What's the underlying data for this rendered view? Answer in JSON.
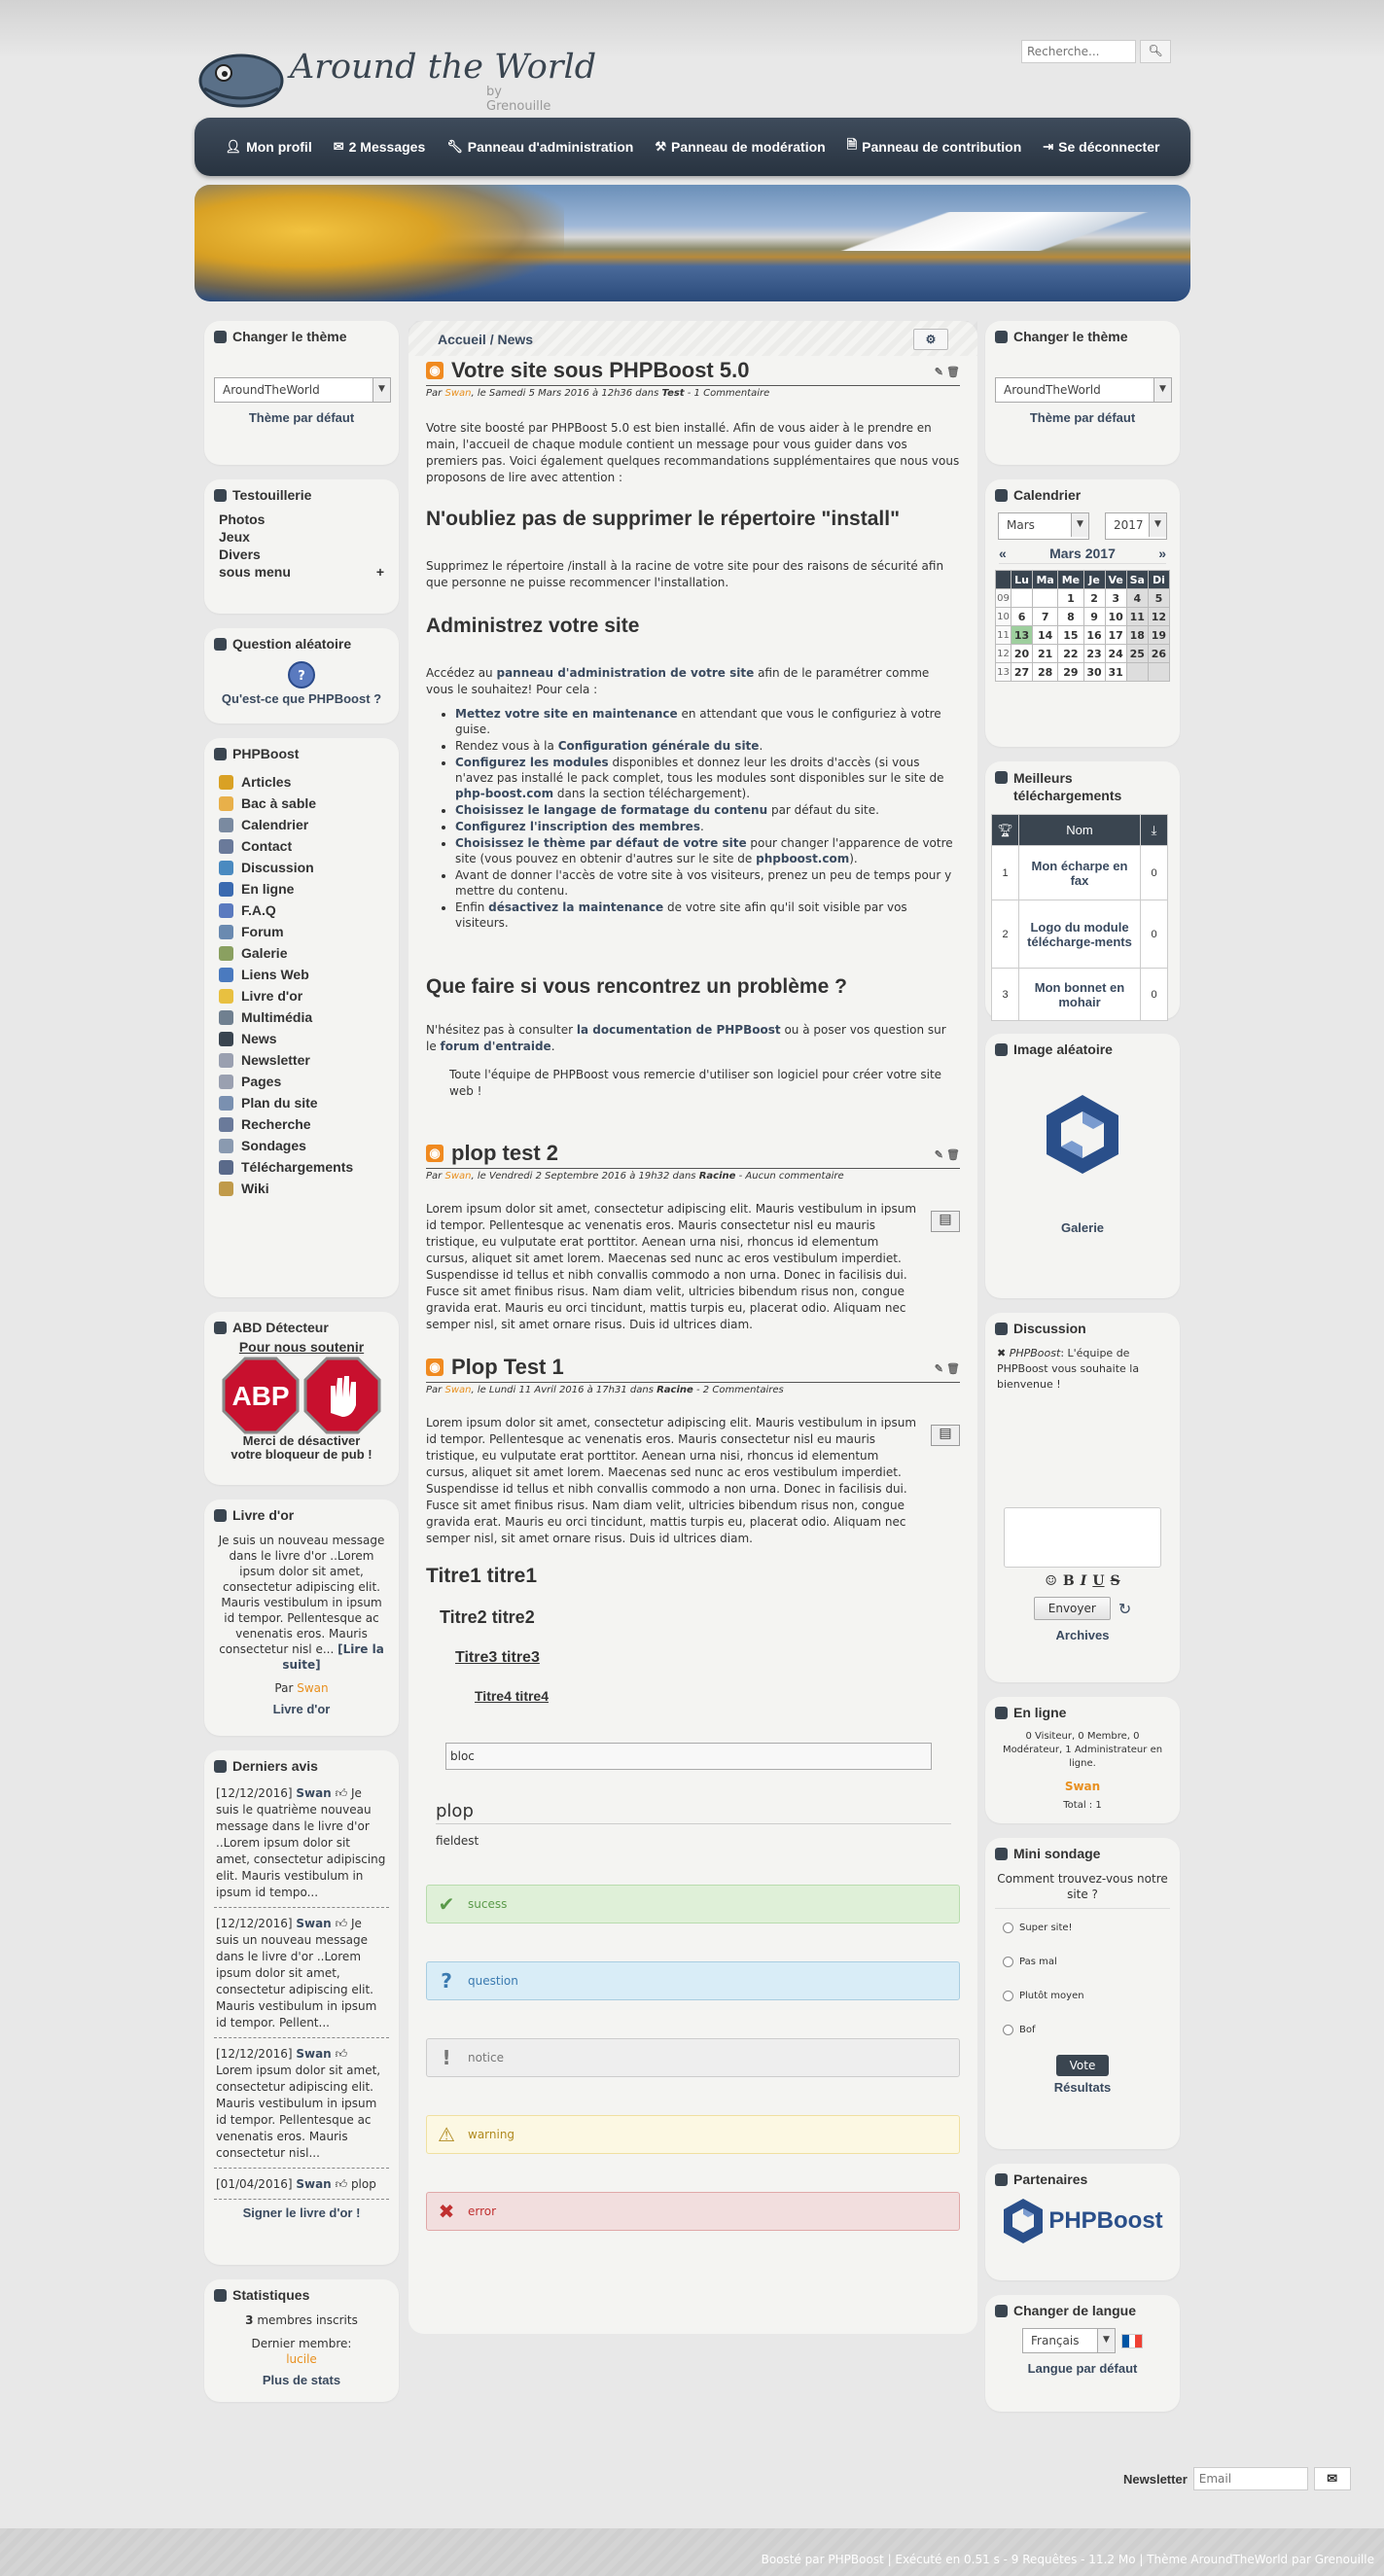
{
  "site": {
    "title": "Around the World",
    "subtitle": "by Grenouille"
  },
  "search": {
    "placeholder": "Recherche..."
  },
  "menu": [
    {
      "icon": "user-icon",
      "label": "Mon profil"
    },
    {
      "icon": "envelope-icon",
      "label": "2 Messages"
    },
    {
      "icon": "wrench-icon",
      "label": "Panneau d'administration"
    },
    {
      "icon": "gavel-icon",
      "label": "Panneau de modération"
    },
    {
      "icon": "file-icon",
      "label": "Panneau de contribution"
    },
    {
      "icon": "sign-out-icon",
      "label": "Se déconnecter"
    }
  ],
  "left": {
    "theme": {
      "title": "Changer le thème",
      "selected": "AroundTheWorld",
      "default_link": "Thème par défaut"
    },
    "testouillerie": {
      "title": "Testouillerie",
      "items": [
        "Photos",
        "Jeux",
        "Divers",
        "sous menu"
      ],
      "expand": "+"
    },
    "random_question": {
      "title": "Question aléatoire",
      "icon_text": "?",
      "link": "Qu'est-ce que PHPBoost ?"
    },
    "phpboost": {
      "title": "PHPBoost",
      "items": [
        "Articles",
        "Bac à sable",
        "Calendrier",
        "Contact",
        "Discussion",
        "En ligne",
        "F.A.Q",
        "Forum",
        "Galerie",
        "Liens Web",
        "Livre d'or",
        "Multimédia",
        "News",
        "Newsletter",
        "Pages",
        "Plan du site",
        "Recherche",
        "Sondages",
        "Téléchargements",
        "Wiki"
      ]
    },
    "abd": {
      "title": "ABD Détecteur",
      "top": "Pour nous soutenir",
      "abp": "ABP",
      "bottom1": "Merci de désactiver",
      "bottom2": "votre bloqueur de pub !"
    },
    "guestbook": {
      "title": "Livre d'or",
      "text": "Je suis un nouveau message dans le livre d'or ..Lorem ipsum dolor sit amet, consectetur adipiscing elit. Mauris vestibulum in ipsum id tempor. Pellentesque ac venenatis eros. Mauris consectetur nisl e...",
      "read": "[Lire la suite]",
      "by": "Par",
      "author": "Swan",
      "link": "Livre d'or"
    },
    "reviews": {
      "title": "Derniers avis",
      "items": [
        {
          "date": "[12/12/2016]",
          "user": "Swan",
          "text": "Je suis le quatrième nouveau message dans le livre d'or ..Lorem ipsum dolor sit amet, consectetur adipiscing elit. Mauris vestibulum in ipsum id tempo..."
        },
        {
          "date": "[12/12/2016]",
          "user": "Swan",
          "text": "Je suis un nouveau message dans le livre d'or ..Lorem ipsum dolor sit amet, consectetur adipiscing elit. Mauris vestibulum in ipsum id tempor. Pellent..."
        },
        {
          "date": "[12/12/2016]",
          "user": "Swan",
          "text": "Lorem ipsum dolor sit amet, consectetur adipiscing elit. Mauris vestibulum in ipsum id tempor. Pellentesque ac venenatis eros. Mauris consectetur nisl..."
        },
        {
          "date": "[01/04/2016]",
          "user": "Swan",
          "text": "plop"
        }
      ],
      "sign": "Signer le livre d'or !"
    },
    "stats": {
      "title": "Statistiques",
      "members": "3",
      "members_label": "membres inscrits",
      "last_label": "Dernier membre:",
      "last": "lucile",
      "more": "Plus de stats"
    }
  },
  "main": {
    "breadcrumb": {
      "home": "Accueil",
      "sep": "/",
      "current": "News"
    },
    "settings_icon": "gear-icon",
    "articles": [
      {
        "title": "Votre site sous PHPBoost 5.0",
        "meta_by": "Par",
        "author": "Swan",
        "meta_date": ", le Samedi 5 Mars 2016 à 12h36 dans",
        "category": "Test",
        "comments": "- 1 Commentaire"
      },
      {
        "title": "plop test 2",
        "meta_by": "Par",
        "author": "Swan",
        "meta_date": ", le Vendredi 2 Septembre 2016 à 19h32 dans",
        "category": "Racine",
        "comments": "- Aucun commentaire"
      },
      {
        "title": "Plop Test 1",
        "meta_by": "Par",
        "author": "Swan",
        "meta_date": ", le Lundi 11 Avril 2016 à 17h31 dans",
        "category": "Racine",
        "comments": "- 2 Commentaires"
      }
    ],
    "intro": "Votre site boosté par PHPBoost 5.0 est bien installé. Afin de vous aider à le prendre en main, l'accueil de chaque module contient un message pour vous guider dans vos premiers pas. Voici également quelques recommandations supplémentaires que nous vous proposons de lire avec attention :",
    "h_install": "N'oubliez pas de supprimer le répertoire \"install\"",
    "p_install": "Supprimez le répertoire /install à la racine de votre site pour des raisons de sécurité afin que personne ne puisse recommencer l'installation.",
    "h_admin": "Administrez votre site",
    "p_admin_a": "Accédez au",
    "p_admin_link": "panneau d'administration de votre site",
    "p_admin_b": "afin de le paramétrer comme vous le souhaitez! Pour cela :",
    "bullets": [
      {
        "b": "Mettez votre site en maintenance",
        "t": " en attendant que vous le configuriez à votre guise."
      },
      {
        "b": "",
        "t": "Rendez vous à la ",
        "b2": "Configuration générale du site",
        "t2": "."
      },
      {
        "b": "Configurez les modules",
        "t": " disponibles et donnez leur les droits d'accès (si vous n'avez pas installé le pack complet, tous les modules sont disponibles sur le site de ",
        "b2": "php-boost.com",
        "t2": " dans la section téléchargement)."
      },
      {
        "b": "Choisissez le langage de formatage du contenu",
        "t": " par défaut du site."
      },
      {
        "b": "Configurez l'inscription des membres",
        "t": "."
      },
      {
        "b": "Choisissez le thème par défaut de votre site",
        "t": " pour changer l'apparence de votre site (vous pouvez en obtenir d'autres sur le site de ",
        "b2": "phpboost.com",
        "t2": ")."
      },
      {
        "b": "",
        "t": "Avant de donner l'accès de votre site à vos visiteurs, prenez un peu de temps pour y mettre du contenu."
      },
      {
        "b": "",
        "t": "Enfin ",
        "b2": "désactivez la maintenance",
        "t2": " de votre site afin qu'il soit visible par vos visiteurs."
      }
    ],
    "h_problem": "Que faire si vous rencontrez un problème ?",
    "p_problem_a": "N'hésitez pas à consulter",
    "p_problem_link1": "la documentation de PHPBoost",
    "p_problem_b": "ou à poser vos question sur le",
    "p_problem_link2": "forum d'entraide",
    "thanks": "Toute l'équipe de PHPBoost vous remercie d'utiliser son logiciel pour créer votre site web !",
    "lorem": "Lorem ipsum dolor sit amet, consectetur adipiscing elit. Mauris vestibulum in ipsum id tempor. Pellentesque ac venenatis eros. Mauris consectetur nisl eu mauris tristique, eu vulputate erat porttitor. Aenean urna nisi, rhoncus id elementum cursus, aliquet sit amet lorem. Maecenas sed nunc ac eros vestibulum imperdiet. Suspendisse id tellus et nibh convallis commodo a non urna. Donec in facilisis dui. Fusce sit amet finibus risus. Nam diam velit, ultricies bibendum risus non, congue gravida erat. Mauris eu orci tincidunt, mattis turpis eu, placerat odio. Aliquam nec semper nisl, sit amet ornare risus. Duis id ultrices diam.",
    "t1": "Titre1 titre1",
    "t2": "Titre2 titre2",
    "t3": "Titre3 titre3",
    "t4": "Titre4 titre4",
    "bloc": "bloc",
    "fieldset_legend": "plop",
    "fieldset_body": "fieldest",
    "messages": [
      {
        "type": "success",
        "icon": "check-icon",
        "glyph": "✔",
        "label": "sucess",
        "bg": "#dff0d8",
        "border": "#b8dcae",
        "color": "#5a9a4a"
      },
      {
        "type": "question",
        "icon": "question-icon",
        "glyph": "?",
        "label": "question",
        "bg": "#d9edf7",
        "border": "#a9cde0",
        "color": "#3a7ab0"
      },
      {
        "type": "notice",
        "icon": "exclamation-icon",
        "glyph": "!",
        "label": "notice",
        "bg": "#eeeeee",
        "border": "#cccccc",
        "color": "#777777"
      },
      {
        "type": "warning",
        "icon": "warning-icon",
        "glyph": "⚠",
        "label": "warning",
        "bg": "#fcf8e3",
        "border": "#f0e0a0",
        "color": "#b08a20"
      },
      {
        "type": "error",
        "icon": "error-icon",
        "glyph": "✖",
        "label": "error",
        "bg": "#f2dede",
        "border": "#e0a8a8",
        "color": "#c03030"
      }
    ]
  },
  "right": {
    "theme": {
      "title": "Changer le thème",
      "selected": "AroundTheWorld",
      "default_link": "Thème par défaut"
    },
    "calendar": {
      "title": "Calendrier",
      "month_sel": "Mars",
      "year_sel": "2017",
      "heading": "Mars 2017",
      "prev": "«",
      "next": "»",
      "days": [
        "Lu",
        "Ma",
        "Me",
        "Je",
        "Ve",
        "Sa",
        "Di"
      ],
      "weeks": [
        {
          "n": "09",
          "d": [
            "",
            "",
            "1",
            "2",
            "3",
            "4",
            "5"
          ]
        },
        {
          "n": "10",
          "d": [
            "6",
            "7",
            "8",
            "9",
            "10",
            "11",
            "12"
          ]
        },
        {
          "n": "11",
          "d": [
            "13",
            "14",
            "15",
            "16",
            "17",
            "18",
            "19"
          ]
        },
        {
          "n": "12",
          "d": [
            "20",
            "21",
            "22",
            "23",
            "24",
            "25",
            "26"
          ]
        },
        {
          "n": "13",
          "d": [
            "27",
            "28",
            "29",
            "30",
            "31",
            "",
            ""
          ]
        }
      ],
      "today": "13"
    },
    "downloads": {
      "title": "Meilleurs téléchargements",
      "col": "Nom",
      "rows": [
        {
          "rank": "1",
          "name": "Mon écharpe en fax",
          "count": "0"
        },
        {
          "rank": "2",
          "name": "Logo du module télécharge-ments",
          "count": "0"
        },
        {
          "rank": "3",
          "name": "Mon bonnet en mohair",
          "count": "0"
        }
      ]
    },
    "random_image": {
      "title": "Image aléatoire",
      "link": "Galerie"
    },
    "shoutbox": {
      "title": "Discussion",
      "user": "PHPBoost",
      "msg": ": L'équipe de PHPBoost vous souhaite la bienvenue !",
      "format": [
        "☺",
        "B",
        "I",
        "U",
        "S"
      ],
      "send": "Envoyer",
      "archives": "Archives"
    },
    "online": {
      "title": "En ligne",
      "summary": "0 Visiteur, 0 Membre, 0 Modérateur, 1 Administrateur en ligne.",
      "user": "Swan",
      "total": "Total : 1"
    },
    "poll": {
      "title": "Mini sondage",
      "question": "Comment trouvez-vous notre site ?",
      "options": [
        "Super site!",
        "Pas mal",
        "Plutôt moyen",
        "Bof"
      ],
      "vote": "Vote",
      "results": "Résultats"
    },
    "partners": {
      "title": "Partenaires",
      "brand": "PHPBoost"
    },
    "language": {
      "title": "Changer de langue",
      "selected": "Français",
      "default_link": "Langue par défaut"
    }
  },
  "newsletter": {
    "label": "Newsletter",
    "placeholder": "Email"
  },
  "footer": {
    "text": "Boosté par PHPBoost | Exécuté en 0.51 s - 9 Requêtes - 11.2 Mo | Thème AroundTheWorld par Grenouille"
  }
}
